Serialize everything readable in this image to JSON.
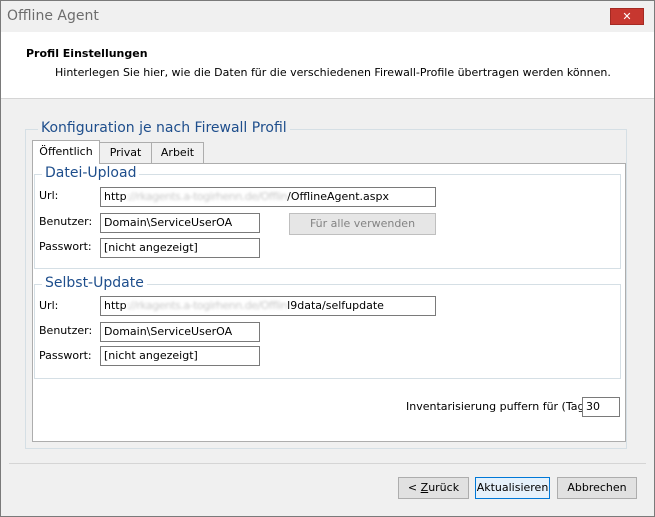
{
  "window": {
    "title": "Offline Agent",
    "close_label": "✕"
  },
  "header": {
    "title": "Profil Einstellungen",
    "description": "Hinterlegen Sie hier, wie die Daten für die verschiedenen Firewall-Profile übertragen werden können."
  },
  "config": {
    "legend": "Konfiguration je nach Firewall Profil",
    "tabs": [
      {
        "label": "Öffentlich",
        "active": true
      },
      {
        "label": "Privat",
        "active": false
      },
      {
        "label": "Arbeit",
        "active": false
      }
    ]
  },
  "upload": {
    "legend": "Datei-Upload",
    "url_label": "Url:",
    "url_prefix": "http",
    "url_hidden": "://rkagents.a-togirhenn.de/Offlin",
    "url_suffix": "/OfflineAgent.aspx",
    "user_label": "Benutzer:",
    "user_value": "Domain\\ServiceUserOA",
    "password_label": "Passwort:",
    "password_value": "[nicht angezeigt]",
    "apply_all_label": "Für alle verwenden"
  },
  "selfupdate": {
    "legend": "Selbst-Update",
    "url_label": "Url:",
    "url_prefix": "http",
    "url_hidden": "://rkagents.a-togirhenn.de/Offlin",
    "url_suffix": "l9data/selfupdate",
    "user_label": "Benutzer:",
    "user_value": "Domain\\ServiceUserOA",
    "password_label": "Passwort:",
    "password_value": "[nicht angezeigt]"
  },
  "buffer": {
    "label": "Inventarisierung puffern für (Tage):",
    "value": "30"
  },
  "footer": {
    "back_prefix": "< ",
    "back_underlined": "Z",
    "back_rest": "urück",
    "update_label": "Aktualisieren",
    "cancel_label": "Abbrechen"
  }
}
